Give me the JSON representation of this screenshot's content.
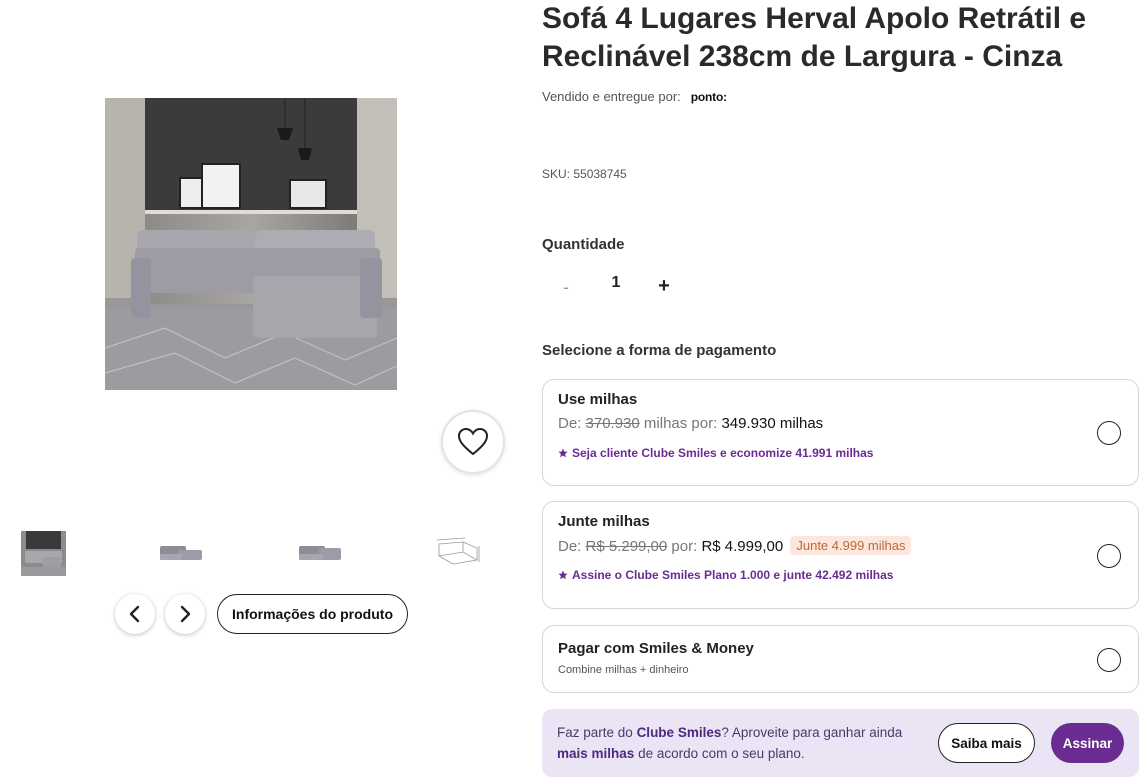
{
  "product": {
    "title": "Sofá 4 Lugares Herval Apolo Retrátil e Reclinável 238cm de Largura - Cinza",
    "seller_prefix": "Vendido e entregue por:",
    "seller_logo": "ponto:",
    "sku": "SKU: 55038745"
  },
  "quantity": {
    "label": "Quantidade",
    "minus": "-",
    "value": "1",
    "plus": "+"
  },
  "payment": {
    "label": "Selecione a forma de pagamento",
    "options": [
      {
        "title": "Use milhas",
        "price_prefix": "De:",
        "price_old": "370.930",
        "price_mid": "milhas por:",
        "price_new": "349.930 milhas",
        "promo": "Seja cliente Clube Smiles e economize 41.991 milhas"
      },
      {
        "title": "Junte milhas",
        "price_prefix": "De:",
        "price_old": "R$ 5.299,00",
        "price_mid": "por:",
        "price_new": "R$ 4.999,00",
        "badge": "Junte 4.999 milhas",
        "promo": "Assine o Clube Smiles Plano 1.000 e junte 42.492 milhas"
      },
      {
        "title": "Pagar com Smiles & Money",
        "subtitle": "Combine milhas + dinheiro"
      }
    ]
  },
  "banner": {
    "text_1": "Faz parte do",
    "brand": "Clube Smiles",
    "text_2": "? Aproveite para ganhar ainda",
    "highlight": "mais milhas",
    "text_3": "de acordo com o seu plano.",
    "saiba_mais": "Saiba mais",
    "assinar": "Assinar"
  },
  "gallery": {
    "info_button": "Informações do produto",
    "thumbnail_count": 4,
    "selected_thumbnail": 1
  },
  "colors": {
    "accent": "#6a2c91",
    "banner_bg": "#ebe4f5",
    "badge_bg": "#fde7dc"
  }
}
